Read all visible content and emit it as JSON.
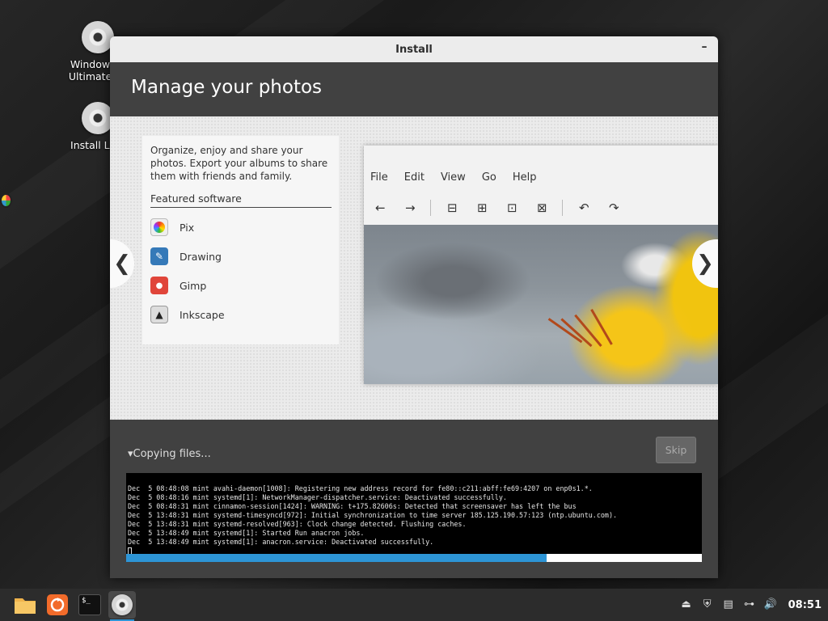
{
  "desktop": {
    "icons": [
      {
        "label_line1": "Windows V",
        "label_line2": "Ultimate Fir"
      },
      {
        "label_line1": "Install Linu",
        "label_line2": ""
      }
    ]
  },
  "window": {
    "title": "Install",
    "minimize_symbol": "–",
    "header": "Manage your photos"
  },
  "slide": {
    "description": "Organize, enjoy and share your photos. Export your albums to share them with friends and family.",
    "featured_title": "Featured software",
    "apps": [
      {
        "name": "Pix",
        "icon": "pix-icon"
      },
      {
        "name": "Drawing",
        "icon": "drawing-icon"
      },
      {
        "name": "Gimp",
        "icon": "gimp-icon"
      },
      {
        "name": "Inkscape",
        "icon": "inkscape-icon"
      }
    ],
    "preview_menu": [
      "File",
      "Edit",
      "View",
      "Go",
      "Help"
    ],
    "prev_symbol": "❮",
    "next_symbol": "❯"
  },
  "progress": {
    "status": "▾Copying files...",
    "skip_label": "Skip",
    "fraction": 0.73,
    "log_lines": [
      "Dec  5 08:48:08 mint avahi-daemon[1008]: Registering new address record for fe80::c211:abff:fe69:4207 on enp0s1.*.",
      "Dec  5 08:48:16 mint systemd[1]: NetworkManager-dispatcher.service: Deactivated successfully.",
      "Dec  5 08:48:31 mint cinnamon-session[1424]: WARNING: t+175.82606s: Detected that screensaver has left the bus",
      "Dec  5 13:48:31 mint systemd-timesyncd[972]: Initial synchronization to time server 185.125.190.57:123 (ntp.ubuntu.com).",
      "Dec  5 13:48:31 mint systemd-resolved[963]: Clock change detected. Flushing caches.",
      "Dec  5 13:48:49 mint systemd[1]: Started Run anacron jobs.",
      "Dec  5 13:48:49 mint systemd[1]: anacron.service: Deactivated successfully."
    ]
  },
  "taskbar": {
    "clock": "08:51",
    "terminal_prompt": "$_"
  },
  "colors": {
    "accent": "#2d95d6",
    "window_bg": "#414141",
    "titlebar_bg": "#ececec"
  }
}
